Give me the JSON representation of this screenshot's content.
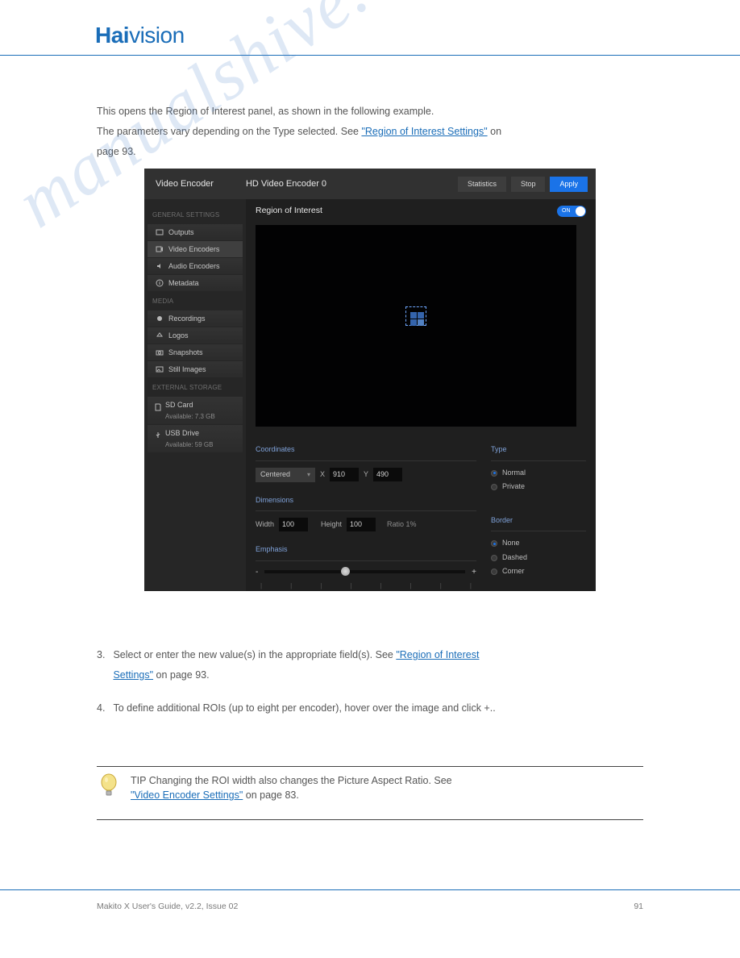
{
  "logo": {
    "part1": "Hai",
    "part2": "vision"
  },
  "intro": {
    "line1": "This opens the Region of Interest panel, as shown in the following example.",
    "line2_pre": "The parameters vary depending on the Type selected. See ",
    "line2_link": "\"Region of Interest Settings\"",
    "line2_post": " on",
    "line3": "page 93."
  },
  "app": {
    "title1": "Video Encoder",
    "title2": "HD Video Encoder 0",
    "btn_stats": "Statistics",
    "btn_stop": "Stop",
    "btn_apply": "Apply",
    "roi_label": "Region of Interest",
    "toggle_on": "ON",
    "side": {
      "sec1": "GENERAL SETTINGS",
      "items1": [
        {
          "icon": "outputs",
          "label": "Outputs"
        },
        {
          "icon": "video",
          "label": "Video Encoders"
        },
        {
          "icon": "audio",
          "label": "Audio Encoders"
        },
        {
          "icon": "meta",
          "label": "Metadata"
        }
      ],
      "sec2": "MEDIA",
      "items2": [
        {
          "icon": "rec",
          "label": "Recordings"
        },
        {
          "icon": "logo",
          "label": "Logos"
        },
        {
          "icon": "snap",
          "label": "Snapshots"
        },
        {
          "icon": "still",
          "label": "Still Images"
        }
      ],
      "sec3": "EXTERNAL STORAGE",
      "storage": [
        {
          "label": "SD Card",
          "avail": "Available: 7.3 GB"
        },
        {
          "label": "USB Drive",
          "avail": "Available: 59 GB"
        }
      ]
    },
    "coord": {
      "label": "Coordinates",
      "mode": "Centered",
      "x_lbl": "X",
      "x": "910",
      "y_lbl": "Y",
      "y": "490"
    },
    "dim": {
      "label": "Dimensions",
      "w_lbl": "Width",
      "w": "100",
      "h_lbl": "Height",
      "h": "100",
      "ratio": "Ratio 1%"
    },
    "emph": {
      "label": "Emphasis",
      "minus": "-",
      "plus": "+"
    },
    "type": {
      "label": "Type",
      "opts": [
        "Normal",
        "Private"
      ]
    },
    "border": {
      "label": "Border",
      "opts": [
        "None",
        "Dashed",
        "Corner"
      ]
    }
  },
  "step3": {
    "num": "3.",
    "l1_pre": "Select or enter the new value(s) in the appropriate field(s). See ",
    "l1_link": "\"Region of Interest",
    "l2_link": "Settings\"",
    "l2_post": " on page 93."
  },
  "step4": {
    "num": "4.",
    "text": "To define additional ROIs (up to eight per encoder), hover over the image and click +.."
  },
  "tip": {
    "label": "TIP",
    "pre": "Changing the ROI width also changes the Picture Aspect Ratio. See ",
    "link": "\"Video Encoder Settings\"",
    "post": " on page 83."
  },
  "footer": {
    "left": "Makito X User's Guide, v2.2, Issue 02",
    "right": "91"
  },
  "wm": "manualshive.com"
}
